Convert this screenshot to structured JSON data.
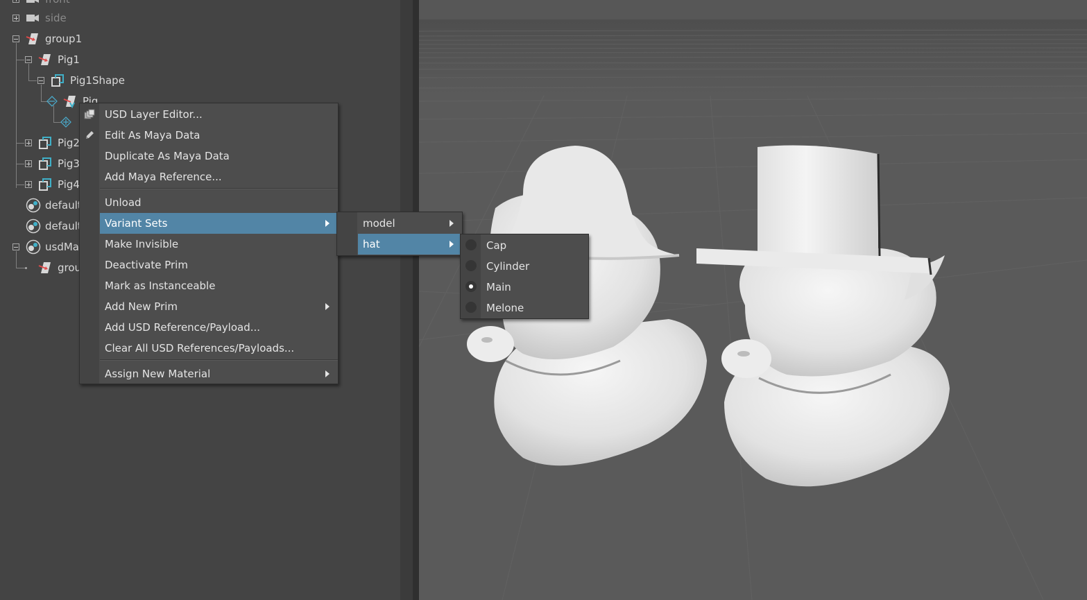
{
  "outliner": {
    "items": [
      {
        "label": "front"
      },
      {
        "label": "side"
      },
      {
        "label": "group1"
      },
      {
        "label": "Pig1"
      },
      {
        "label": "Pig1Shape"
      },
      {
        "label": "Pig"
      },
      {
        "label": "Pig2"
      },
      {
        "label": "Pig3"
      },
      {
        "label": "Pig4"
      },
      {
        "label": "default"
      },
      {
        "label": "default"
      },
      {
        "label": "usdMa"
      },
      {
        "label": "grou"
      }
    ]
  },
  "context_menu": {
    "items": [
      {
        "label": "USD Layer Editor...",
        "icon": "layers-icon"
      },
      {
        "label": "Edit As Maya Data",
        "icon": "pencil-icon"
      },
      {
        "label": "Duplicate As Maya Data"
      },
      {
        "label": "Add Maya Reference..."
      },
      {
        "label": "Unload"
      },
      {
        "label": "Variant Sets",
        "highlighted": true,
        "submenu": true
      },
      {
        "label": "Make Invisible"
      },
      {
        "label": "Deactivate Prim"
      },
      {
        "label": "Mark as Instanceable"
      },
      {
        "label": "Add New Prim",
        "submenu": true
      },
      {
        "label": "Add USD Reference/Payload..."
      },
      {
        "label": "Clear All USD References/Payloads..."
      },
      {
        "label": "Assign New Material",
        "submenu": true
      }
    ]
  },
  "variant_sets_menu": {
    "items": [
      {
        "label": "model",
        "submenu": true
      },
      {
        "label": "hat",
        "highlighted": true,
        "submenu": true
      }
    ]
  },
  "hat_menu": {
    "selected": "Main",
    "items": [
      {
        "label": "Cap",
        "selected": false
      },
      {
        "label": "Cylinder",
        "selected": false
      },
      {
        "label": "Main",
        "selected": true
      },
      {
        "label": "Melone",
        "selected": false
      }
    ]
  },
  "colors": {
    "highlight": "#5285a6",
    "menu_bg": "#4d4d4d",
    "panel_bg": "#444444",
    "viewport_bg": "#5a5a5a"
  }
}
